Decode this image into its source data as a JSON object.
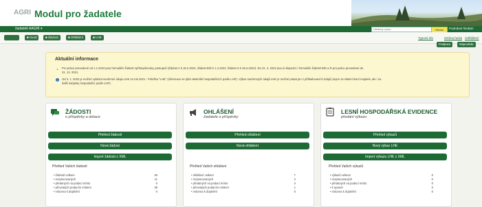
{
  "header": {
    "logo": "AGRI",
    "title": "Modul pro žadatele"
  },
  "topbar": {
    "user_link": "žadatelé AAGRI ▾",
    "search_placeholder": "Hledaný výraz",
    "search_button": "Hledat",
    "help_link": "Podrobné hledání"
  },
  "toolbar": {
    "buttons": [
      "Úvod",
      "Žádosti",
      "Ohlášení",
      "LHE"
    ],
    "links": [
      "Typové Zlo",
      "Změna hesla",
      "Odhlášení"
    ],
    "right_buttons": [
      "Podpora",
      "Nápověda"
    ]
  },
  "info": {
    "title": "Aktuální informace",
    "lines": [
      "Pro práce provedené od 1.1.2022 jsou formuláře žádostí zpřístupňovány postupně (Žádost A k 18.2.2022, Žádost B/D k 1.4.2022, Žádost S k 28.4.2022). Do 31. 3. 2022 jsou k dispozici i formuláře žádostí B/D a R pro práce provedené do",
      "31. 12. 2021.",
      "Od 3. 1. 2022 je možné vykázat souhrnné údaje LHE za rok 2021 - Položka \"LHE\" (informace se týká vlastníků hospodařících podle LHP). Výkaz souhrnných údajů LHE je možné podat jen z přihlašovacích údajů (nejen za vlastní lesní majetek, ale i za",
      "další subjekty hospodařící podle LHP)."
    ]
  },
  "cards": [
    {
      "title": "ŽÁDOSTI",
      "subtitle": "o příspěvky a dotace",
      "buttons": [
        "Přehled žádostí",
        "Nová žádost",
        "Import žádosti z XML"
      ],
      "overview_title": "Přehled Vašich žádostí",
      "rows": [
        {
          "label": "žádostí celkem",
          "value": "49"
        },
        {
          "label": "rozpracovaných",
          "value": "11"
        },
        {
          "label": "předaných na podací místo",
          "value": "0"
        },
        {
          "label": "převzatých podacím místem",
          "value": "38"
        },
        {
          "label": "vrácena k doplnění",
          "value": "0"
        }
      ]
    },
    {
      "title": "OHLÁŠENÍ",
      "subtitle": "žadatele o příspěvky",
      "buttons": [
        "Přehled ohlášení",
        "Nová ohlášení"
      ],
      "overview_title": "Přehled Vašich ohlášení",
      "rows": [
        {
          "label": "ohlášení celkem",
          "value": "7"
        },
        {
          "label": "rozpracovaných",
          "value": "2"
        },
        {
          "label": "předaných na podací místo",
          "value": "4"
        },
        {
          "label": "převzatých podacím místem",
          "value": "1"
        },
        {
          "label": "vrácena k doplnění",
          "value": "0"
        }
      ]
    },
    {
      "title": "LESNÍ HOSPODÁŘSKÁ EVIDENCE",
      "subtitle": "předání výkazu",
      "buttons": [
        "Přehled výkazů",
        "Nový výkaz LHE",
        "Import výkazu LHE z XML"
      ],
      "overview_title": "Přehled Vašich výkazů",
      "rows": [
        {
          "label": "výkazů celkem",
          "value": "0"
        },
        {
          "label": "rozpracovaných",
          "value": "0"
        },
        {
          "label": "předaných na podací místo",
          "value": "0"
        },
        {
          "label": "k opravě",
          "value": "0"
        },
        {
          "label": "vrácena k doplnění",
          "value": "0"
        }
      ]
    }
  ],
  "colors": {
    "brand_green": "#1e6a35",
    "info_background": "#fdf7d0"
  }
}
